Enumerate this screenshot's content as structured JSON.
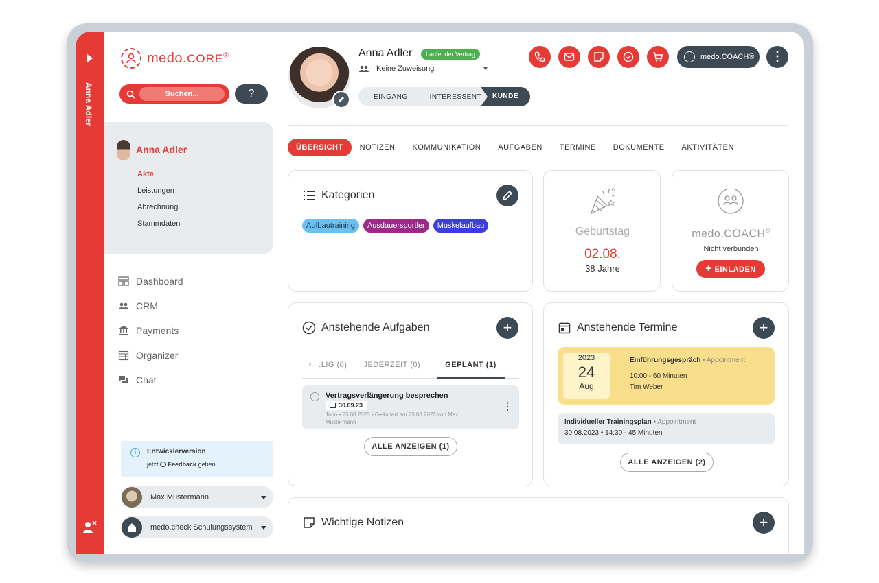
{
  "rail": {
    "user_name": "Anna Adler"
  },
  "sidebar": {
    "logo_main": "medo.",
    "logo_core": "CORE",
    "logo_reg": "®",
    "search_placeholder": "Suchen...",
    "help_label": "?",
    "client": {
      "name": "Anna Adler",
      "links": [
        "Akte",
        "Leistungen",
        "Abrechnung",
        "Stammdaten"
      ]
    },
    "nav": [
      {
        "label": "Dashboard",
        "icon": "dashboard-icon"
      },
      {
        "label": "CRM",
        "icon": "people-icon"
      },
      {
        "label": "Payments",
        "icon": "bank-icon"
      },
      {
        "label": "Organizer",
        "icon": "calendar-grid-icon"
      },
      {
        "label": "Chat",
        "icon": "chat-bubbles-icon"
      }
    ],
    "dev": {
      "title": "Entwicklerversion",
      "prefix": "jetzt",
      "feedback": "Feedback",
      "suffix": "geben"
    },
    "user_select": "Max Mustermann",
    "system_select": "medo.check Schulungssystem"
  },
  "header": {
    "name": "Anna Adler",
    "contract_badge": "Laufender Vertrag",
    "assignment": "Keine Zuweisung",
    "steps": [
      "EINGANG",
      "INTERESSENT",
      "KUNDE"
    ],
    "coach_label": "medo.COACH®",
    "more_label": "⋮"
  },
  "tabs": [
    "ÜBERSICHT",
    "NOTIZEN",
    "KOMMUNIKATION",
    "AUFGABEN",
    "TERMINE",
    "DOKUMENTE",
    "AKTIVITÄTEN"
  ],
  "categories": {
    "title": "Kategorien",
    "tags": [
      {
        "label": "Aufbautraining",
        "bg": "#6cc0f0",
        "fg": "#1a3a52"
      },
      {
        "label": "Ausdauersportler",
        "bg": "#9c2a8b",
        "fg": "#ffffff"
      },
      {
        "label": "Muskelaufbau",
        "bg": "#3b3fe0",
        "fg": "#ffffff"
      }
    ]
  },
  "birthday": {
    "label": "Geburtstag",
    "date": "02.08.",
    "age": "38 Jahre"
  },
  "coach": {
    "brand": "medo.COACH",
    "reg": "®",
    "status": "Nicht verbunden",
    "invite": "EINLADEN"
  },
  "tasks": {
    "title": "Anstehende Aufgaben",
    "subtabs": [
      "‹",
      ".LIG (0)",
      "JEDERZEIT (0)",
      "GEPLANT (1)"
    ],
    "item": {
      "title": "Vertragsverlängerung besprechen",
      "date": "30.09.23",
      "meta1": "Todo • 23.08.2023 • Geändert am 23.08.2023 von Max",
      "meta2": "Mustermann"
    },
    "show_all": "ALLE ANZEIGEN (1)"
  },
  "appointments": {
    "title": "Anstehende Termine",
    "first": {
      "year": "2023",
      "day": "24",
      "month": "Aug",
      "title": "Einführungsgespräch",
      "type": "• Appointment",
      "time": "10:00 - 60 Minuten",
      "person": "Tim Weber"
    },
    "second": {
      "title": "Individueller Trainingsplan",
      "type": "• Appointment",
      "time": "30.08.2023 • 14:30 - 45 Minuten"
    },
    "show_all": "ALLE ANZEIGEN (2)"
  },
  "notes": {
    "title": "Wichtige Notizen"
  },
  "colors": {
    "brand_red": "#e53a35",
    "dark": "#3d4a54",
    "panel": "#e8ecee",
    "appt_yellow": "#f9df8b"
  }
}
